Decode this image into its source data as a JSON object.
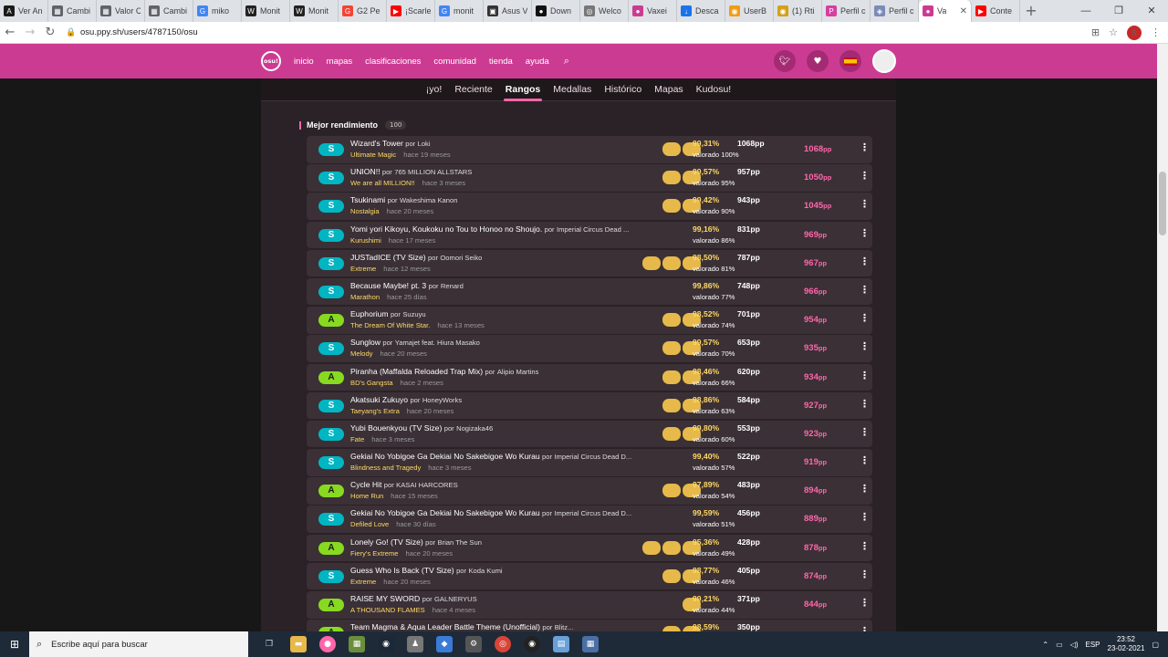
{
  "browser": {
    "tabs": [
      {
        "label": "Ver An",
        "color": "#1a1a1a",
        "icon": "A"
      },
      {
        "label": "Cambi",
        "color": "#5f6368",
        "icon": "▦"
      },
      {
        "label": "Valor C",
        "color": "#5f6368",
        "icon": "▦"
      },
      {
        "label": "Cambi",
        "color": "#5f6368",
        "icon": "▦"
      },
      {
        "label": "miko",
        "color": "#4285f4",
        "icon": "G"
      },
      {
        "label": "Monit",
        "color": "#222",
        "icon": "W"
      },
      {
        "label": "Monit",
        "color": "#222",
        "icon": "W"
      },
      {
        "label": "G2 Pe",
        "color": "#f44336",
        "icon": "G"
      },
      {
        "label": "¡Scarle",
        "color": "#ff0000",
        "icon": "▶"
      },
      {
        "label": "monit",
        "color": "#4285f4",
        "icon": "G"
      },
      {
        "label": "Asus V",
        "color": "#333",
        "icon": "▣"
      },
      {
        "label": "Down",
        "color": "#111",
        "icon": "●"
      },
      {
        "label": "Welco",
        "color": "#777",
        "icon": "◎"
      },
      {
        "label": "Vaxei",
        "color": "#cc3b92",
        "icon": "●"
      },
      {
        "label": "Desca",
        "color": "#1a73e8",
        "icon": "↓"
      },
      {
        "label": "UserB",
        "color": "#f39c12",
        "icon": "◉"
      },
      {
        "label": "(1) Rti",
        "color": "#d4a017",
        "icon": "◉"
      },
      {
        "label": "Perfil c",
        "color": "#d63ea0",
        "icon": "P"
      },
      {
        "label": "Perfil c",
        "color": "#7b8ab8",
        "icon": "◈"
      },
      {
        "label": "Va",
        "color": "#cc3b92",
        "icon": "●",
        "active": true
      },
      {
        "label": "Conte",
        "color": "#ff0000",
        "icon": "▶"
      }
    ],
    "url": "osu.ppy.sh/users/4787150/osu",
    "profile_initial": "s"
  },
  "osu_nav": {
    "logo": "osu!",
    "links": [
      "inicio",
      "mapas",
      "clasificaciones",
      "comunidad",
      "tienda",
      "ayuda"
    ]
  },
  "subtabs": [
    "¡yo!",
    "Reciente",
    "Rangos",
    "Medallas",
    "Histórico",
    "Mapas",
    "Kudosu!"
  ],
  "active_subtab": "Rangos",
  "section": {
    "title": "Mejor rendimiento",
    "count": "100"
  },
  "scores": [
    {
      "grade": "S",
      "title": "Wizard's Tower",
      "artist": "Loki",
      "diff": "Ultimate Magic",
      "ago": "hace 19 meses",
      "mods": [
        "HD",
        "DT"
      ],
      "acc": "99,31%",
      "weight": "valorado 100%",
      "raw": "1068pp",
      "pp": "1068"
    },
    {
      "grade": "S",
      "title": "UNION!!",
      "artist": "765 MILLION ALLSTARS",
      "diff": "We are all MILLION!!",
      "ago": "hace 3 meses",
      "mods": [
        "HD",
        "DT"
      ],
      "acc": "99,57%",
      "weight": "valorado 95%",
      "raw": "957pp",
      "pp": "1050"
    },
    {
      "grade": "S",
      "title": "Tsukinami",
      "artist": "Wakeshima Kanon",
      "diff": "Nostalgia",
      "ago": "hace 20 meses",
      "mods": [
        "HD",
        "DT"
      ],
      "acc": "99,42%",
      "weight": "valorado 90%",
      "raw": "943pp",
      "pp": "1045"
    },
    {
      "grade": "S",
      "title": "Yomi yori Kikoyu, Koukoku no Tou to Honoo no Shoujo.",
      "artist": "Imperial Circus Dead ...",
      "diff": "Kurushimi",
      "ago": "hace 17 meses",
      "mods": [],
      "acc": "99,16%",
      "weight": "valorado 86%",
      "raw": "831pp",
      "pp": "969"
    },
    {
      "grade": "S",
      "title": "JUSTadICE (TV Size)",
      "artist": "Oomori Seiko",
      "diff": "Extreme",
      "ago": "hace 12 meses",
      "mods": [
        "HD",
        "HR",
        "DT"
      ],
      "acc": "98,50%",
      "weight": "valorado 81%",
      "raw": "787pp",
      "pp": "967"
    },
    {
      "grade": "S",
      "title": "Because Maybe! pt. 3",
      "artist": "Renard",
      "diff": "Marathon",
      "ago": "hace 25 días",
      "mods": [],
      "acc": "99,86%",
      "weight": "valorado 77%",
      "raw": "748pp",
      "pp": "966"
    },
    {
      "grade": "A",
      "title": "Euphorium",
      "artist": "Suzuyu",
      "diff": "The Dream Of White Star.",
      "ago": "hace 13 meses",
      "mods": [
        "HD",
        "DT"
      ],
      "acc": "98,52%",
      "weight": "valorado 74%",
      "raw": "701pp",
      "pp": "954"
    },
    {
      "grade": "S",
      "title": "Sunglow",
      "artist": "Yamajet feat. Hiura Masako",
      "diff": "Melody",
      "ago": "hace 20 meses",
      "mods": [
        "HD",
        "DT"
      ],
      "acc": "99,57%",
      "weight": "valorado 70%",
      "raw": "653pp",
      "pp": "935"
    },
    {
      "grade": "A",
      "title": "Piranha (Maffalda Reloaded Trap Mix)",
      "artist": "Alipio Martins",
      "diff": "BD's Gangsta",
      "ago": "hace 2 meses",
      "mods": [
        "HD",
        "DT"
      ],
      "acc": "98,46%",
      "weight": "valorado 66%",
      "raw": "620pp",
      "pp": "934"
    },
    {
      "grade": "S",
      "title": "Akatsuki Zukuyo",
      "artist": "HoneyWorks",
      "diff": "Taeyang's Extra",
      "ago": "hace 20 meses",
      "mods": [
        "HD",
        "DT"
      ],
      "acc": "98,86%",
      "weight": "valorado 63%",
      "raw": "584pp",
      "pp": "927"
    },
    {
      "grade": "S",
      "title": "Yubi Bouenkyou (TV Size)",
      "artist": "Nogizaka46",
      "diff": "Fate",
      "ago": "hace 3 meses",
      "mods": [
        "HD",
        "DT"
      ],
      "acc": "99,80%",
      "weight": "valorado 60%",
      "raw": "553pp",
      "pp": "923"
    },
    {
      "grade": "S",
      "title": "Gekiai No Yobigoe Ga Dekiai No Sakebigoe Wo Kurau",
      "artist": "Imperial Circus Dead D...",
      "diff": "Blindness and Tragedy",
      "ago": "hace 3 meses",
      "mods": [],
      "acc": "99,40%",
      "weight": "valorado 57%",
      "raw": "522pp",
      "pp": "919"
    },
    {
      "grade": "A",
      "title": "Cycle Hit",
      "artist": "KASAI HARCORES",
      "diff": "Home Run",
      "ago": "hace 15 meses",
      "mods": [
        "HD",
        "DT"
      ],
      "acc": "97,89%",
      "weight": "valorado 54%",
      "raw": "483pp",
      "pp": "894"
    },
    {
      "grade": "S",
      "title": "Gekiai No Yobigoe Ga Dekiai No Sakebigoe Wo Kurau",
      "artist": "Imperial Circus Dead D...",
      "diff": "Defiled Love",
      "ago": "hace 30 días",
      "mods": [],
      "acc": "99,59%",
      "weight": "valorado 51%",
      "raw": "456pp",
      "pp": "889"
    },
    {
      "grade": "A",
      "title": "Lonely Go! (TV Size)",
      "artist": "Brian The Sun",
      "diff": "Fiery's Extreme",
      "ago": "hace 20 meses",
      "mods": [
        "HD",
        "HR",
        "DT"
      ],
      "acc": "95,36%",
      "weight": "valorado 49%",
      "raw": "428pp",
      "pp": "878"
    },
    {
      "grade": "S",
      "title": "Guess Who Is Back (TV Size)",
      "artist": "Koda Kumi",
      "diff": "Extreme",
      "ago": "hace 20 meses",
      "mods": [
        "HD",
        "DT"
      ],
      "acc": "98,77%",
      "weight": "valorado 46%",
      "raw": "405pp",
      "pp": "874"
    },
    {
      "grade": "A",
      "title": "RAISE MY SWORD",
      "artist": "GALNERYUS",
      "diff": "A THOUSAND FLAMES",
      "ago": "hace 4 meses",
      "mods": [
        "HR"
      ],
      "acc": "99,21%",
      "weight": "valorado 44%",
      "raw": "371pp",
      "pp": "844"
    },
    {
      "grade": "A",
      "title": "Team Magma & Aqua Leader Battle Theme (Unofficial)",
      "artist": "Blitz...",
      "diff": "",
      "ago": "",
      "mods": [
        "HD",
        "DT"
      ],
      "acc": "98,59%",
      "weight": "",
      "raw": "350pp",
      "pp": ""
    }
  ],
  "by_word": "por",
  "pp_unit": "pp",
  "taskbar": {
    "search_placeholder": "Escribe aquí para buscar",
    "lang": "ESP",
    "time": "23:52",
    "date": "23-02-2021"
  }
}
